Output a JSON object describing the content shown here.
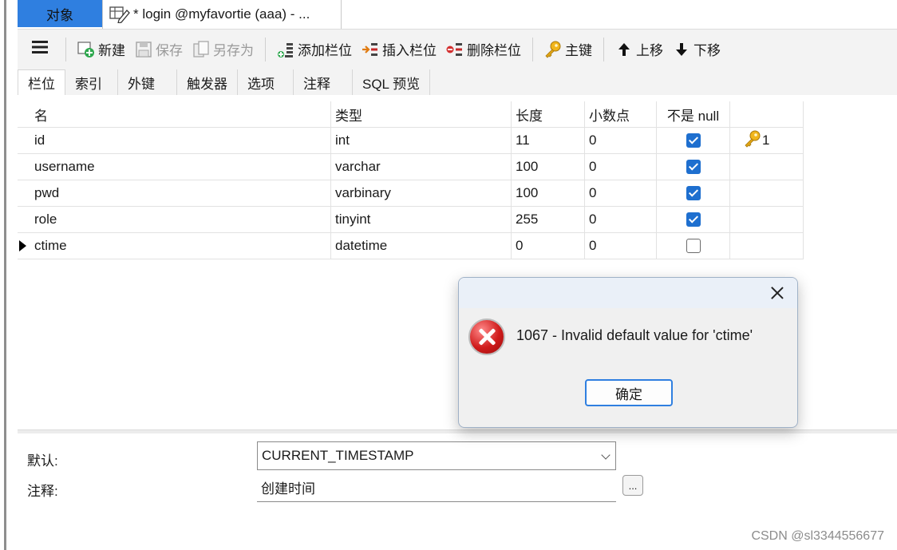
{
  "tabs": {
    "objects_label": "对象",
    "design_label": "* login @myfavortie (aaa) - ..."
  },
  "toolbar": {
    "new_label": "新建",
    "save_label": "保存",
    "save_as_label": "另存为",
    "add_field_label": "添加栏位",
    "insert_field_label": "插入栏位",
    "delete_field_label": "删除栏位",
    "primary_key_label": "主键",
    "move_up_label": "上移",
    "move_down_label": "下移"
  },
  "subtabs": [
    "栏位",
    "索引",
    "外键",
    "触发器",
    "选项",
    "注释",
    "SQL 预览"
  ],
  "grid": {
    "headers": [
      "名",
      "类型",
      "长度",
      "小数点",
      "不是 null",
      ""
    ],
    "rows": [
      {
        "name": "id",
        "type": "int",
        "length": "11",
        "decimals": "0",
        "not_null": true,
        "key": "1"
      },
      {
        "name": "username",
        "type": "varchar",
        "length": "100",
        "decimals": "0",
        "not_null": true,
        "key": ""
      },
      {
        "name": "pwd",
        "type": "varbinary",
        "length": "100",
        "decimals": "0",
        "not_null": true,
        "key": ""
      },
      {
        "name": "role",
        "type": "tinyint",
        "length": "255",
        "decimals": "0",
        "not_null": true,
        "key": ""
      },
      {
        "name": "ctime",
        "type": "datetime",
        "length": "0",
        "decimals": "0",
        "not_null": false,
        "key": ""
      }
    ]
  },
  "props": {
    "default_label": "默认:",
    "default_value": "CURRENT_TIMESTAMP",
    "comment_label": "注释:",
    "comment_value": "创建时间",
    "ellipsis_label": "..."
  },
  "dialog": {
    "message": "1067 - Invalid default value for 'ctime'",
    "ok_label": "确定"
  },
  "watermark": "CSDN @sl3344556677",
  "colors": {
    "accent": "#2f7fe0",
    "checkbox": "#1e6fcf",
    "error": "#d01c1c"
  }
}
